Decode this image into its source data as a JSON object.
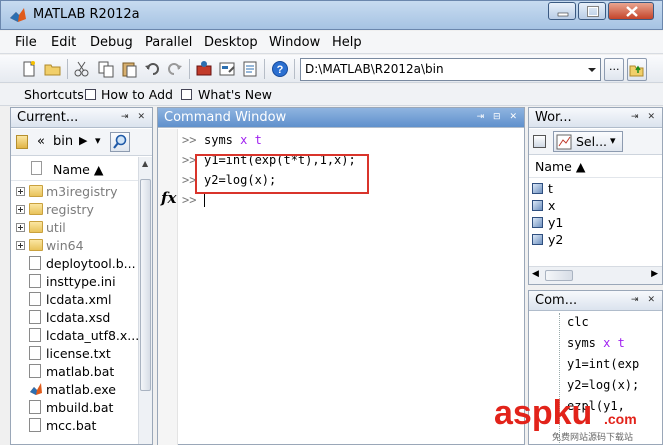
{
  "window": {
    "title": "MATLAB  R2012a"
  },
  "menu": [
    "File",
    "Edit",
    "Debug",
    "Parallel",
    "Desktop",
    "Window",
    "Help"
  ],
  "toolbar": {
    "path": "D:\\MATLAB\\R2012a\\bin",
    "browse_label": "...",
    "help_icon": "help-icon"
  },
  "shortcuts": {
    "label": "Shortcuts",
    "items": [
      "How to Add",
      "What's New"
    ]
  },
  "current_folder": {
    "title": "Current...",
    "crumb_prefix": "«",
    "crumb": "bin",
    "column": "Name ▲",
    "items": [
      {
        "name": "m3iregistry",
        "kind": "folder",
        "expandable": true
      },
      {
        "name": "registry",
        "kind": "folder",
        "expandable": true
      },
      {
        "name": "util",
        "kind": "folder",
        "expandable": true
      },
      {
        "name": "win64",
        "kind": "folder",
        "expandable": true
      },
      {
        "name": "deploytool.b...",
        "kind": "file"
      },
      {
        "name": "insttype.ini",
        "kind": "file"
      },
      {
        "name": "lcdata.xml",
        "kind": "file"
      },
      {
        "name": "lcdata.xsd",
        "kind": "file"
      },
      {
        "name": "lcdata_utf8.x...",
        "kind": "file"
      },
      {
        "name": "license.txt",
        "kind": "file"
      },
      {
        "name": "matlab.bat",
        "kind": "file"
      },
      {
        "name": "matlab.exe",
        "kind": "exe"
      },
      {
        "name": "mbuild.bat",
        "kind": "file"
      },
      {
        "name": "mcc.bat",
        "kind": "file"
      }
    ]
  },
  "command_window": {
    "title": "Command Window",
    "fx": "fx",
    "prompt": ">>",
    "lines": [
      {
        "cmd": "syms",
        "args": "x t"
      },
      {
        "cmd": "y1=int(exp(t*t),1,x);",
        "args": ""
      },
      {
        "cmd": "y2=log(x);",
        "args": ""
      }
    ]
  },
  "workspace": {
    "title": "Wor...",
    "select_label": "Sel...",
    "column": "Name ▲",
    "vars": [
      "t",
      "x",
      "y1",
      "y2"
    ]
  },
  "history": {
    "title": "Com...",
    "items": [
      {
        "cmd": "clc",
        "args": ""
      },
      {
        "cmd": "syms",
        "args": "x t"
      },
      {
        "cmd": "y1=int(exp",
        "args": ""
      },
      {
        "cmd": "y2=log(x);",
        "args": ""
      },
      {
        "cmd": "ezpl(y1,",
        "args": ""
      }
    ]
  },
  "watermark": {
    "brand": "aspku",
    "tld": ".com",
    "tagline": "免费网站源码下载站"
  },
  "colors": {
    "keyword_args": "#a020f0",
    "annotation": "#d9342b",
    "active_header": "#5f90cc"
  }
}
